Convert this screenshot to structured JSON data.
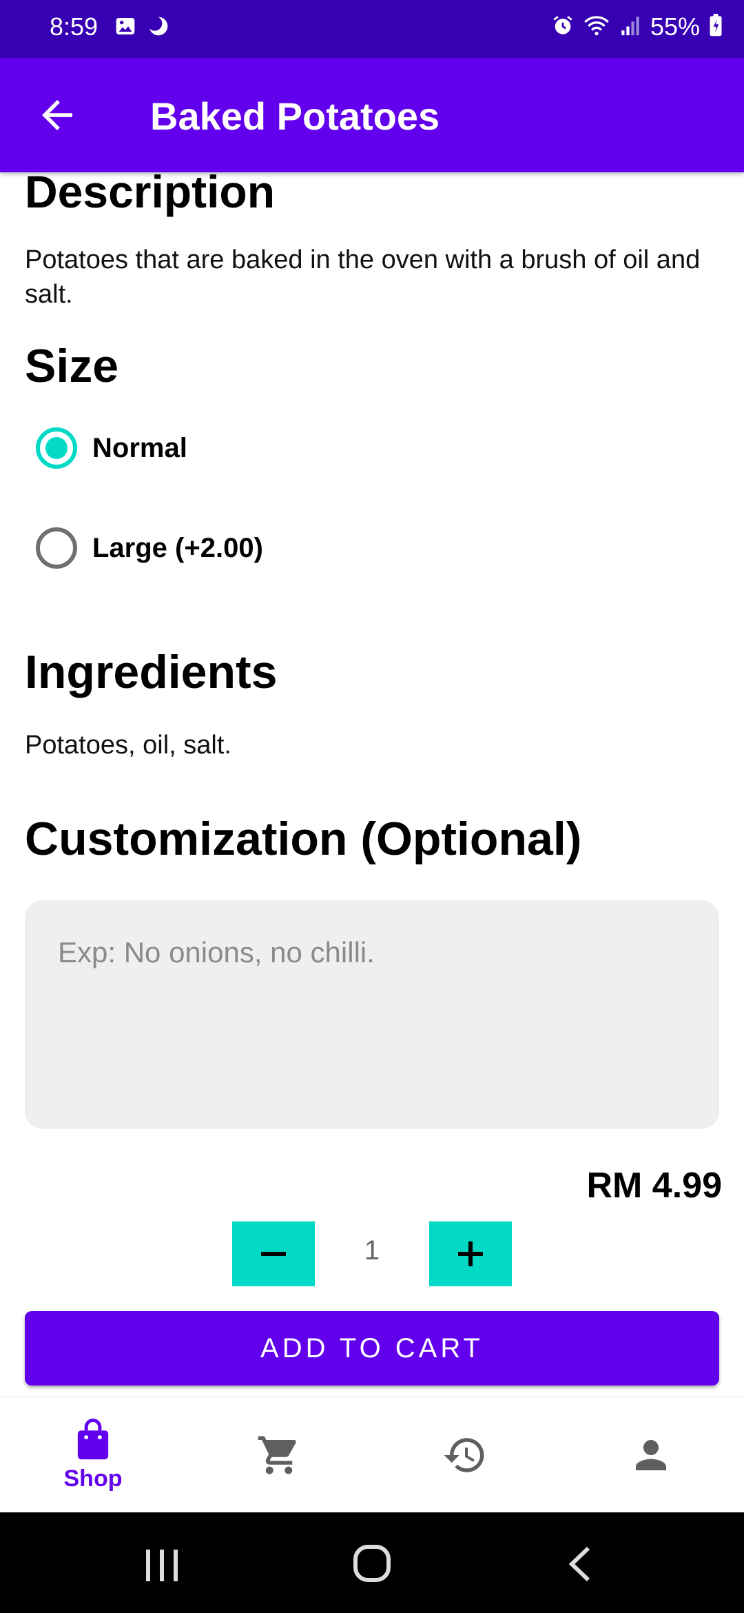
{
  "status_bar": {
    "time": "8:59",
    "battery": "55%",
    "icons": [
      "image-icon",
      "moon-icon",
      "alarm-icon",
      "wifi-icon",
      "signal-icon",
      "battery-icon"
    ]
  },
  "app_bar": {
    "title": "Baked Potatoes",
    "back_icon": "arrow-back-icon"
  },
  "description": {
    "heading": "Description",
    "text": "Potatoes that are baked in the oven with a brush of oil and salt."
  },
  "size": {
    "heading": "Size",
    "options": [
      {
        "label": "Normal",
        "selected": true
      },
      {
        "label": "Large (+2.00)",
        "selected": false
      }
    ]
  },
  "ingredients": {
    "heading": "Ingredients",
    "text": "Potatoes, oil, salt."
  },
  "customization": {
    "heading": "Customization (Optional)",
    "placeholder": "Exp: No onions, no chilli.",
    "value": ""
  },
  "price": "RM 4.99",
  "quantity": {
    "value": "1",
    "decrease_icon": "minus-icon",
    "increase_icon": "plus-icon"
  },
  "add_to_cart_label": "ADD TO CART",
  "bottom_nav": {
    "items": [
      {
        "label": "Shop",
        "icon": "shopping-bag-icon",
        "active": true
      },
      {
        "label": "",
        "icon": "cart-icon",
        "active": false
      },
      {
        "label": "",
        "icon": "history-icon",
        "active": false
      },
      {
        "label": "",
        "icon": "person-icon",
        "active": false
      }
    ]
  },
  "colors": {
    "status_bar": "#3700b3",
    "primary": "#6200ee",
    "accent": "#03dac5",
    "field_bg": "#efefef"
  }
}
